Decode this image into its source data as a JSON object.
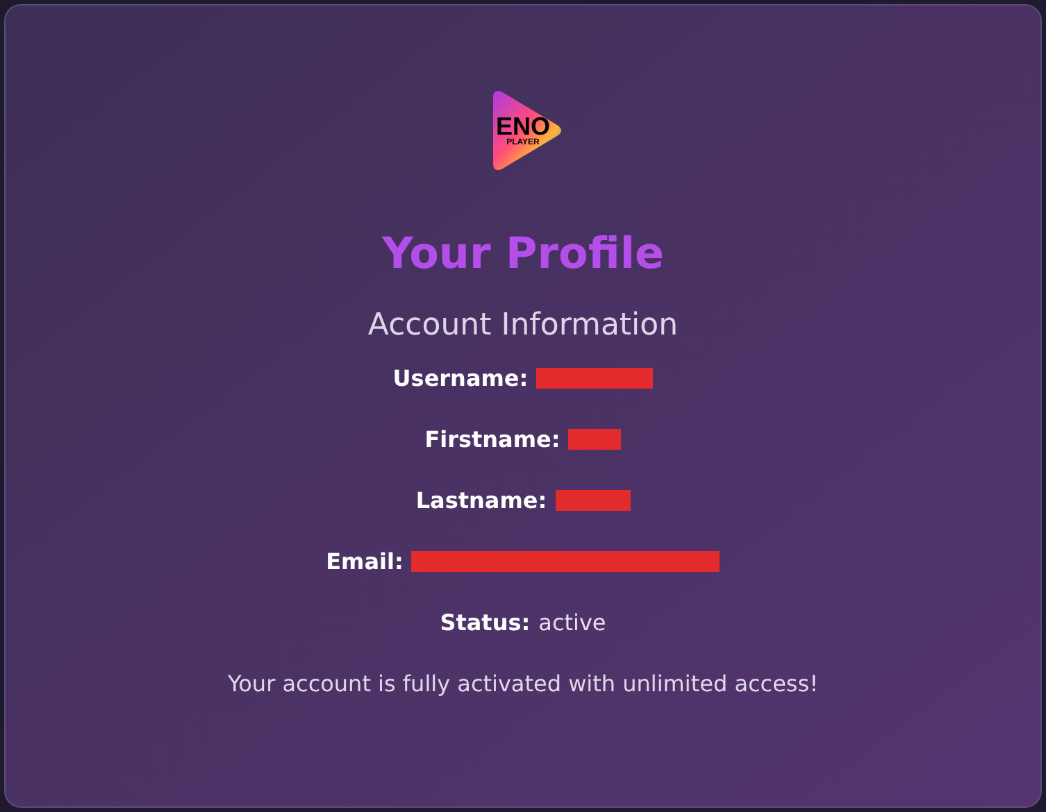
{
  "logo": {
    "word": "ENO",
    "sub": "PLAYER"
  },
  "title": "Your Profile",
  "section_title": "Account Information",
  "fields": [
    {
      "label": "Username:",
      "redacted": true
    },
    {
      "label": "Firstname:",
      "redacted": true
    },
    {
      "label": "Lastname:",
      "redacted": true
    },
    {
      "label": "Email:",
      "redacted": true
    },
    {
      "label": "Status:",
      "redacted": false,
      "value": "active"
    }
  ],
  "message": "Your account is fully activated with unlimited access!"
}
